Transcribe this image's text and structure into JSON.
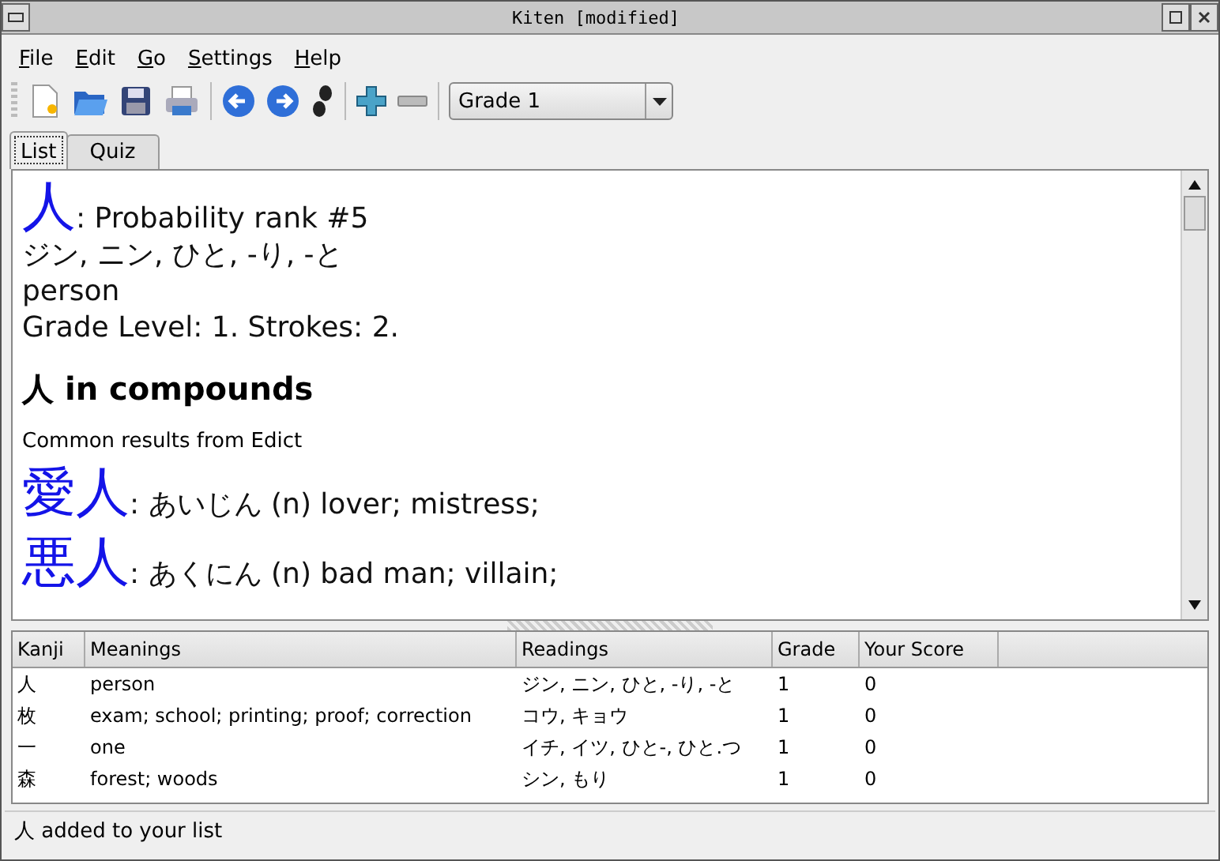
{
  "window": {
    "title": "Kiten [modified]"
  },
  "menu": [
    "File",
    "Edit",
    "Go",
    "Settings",
    "Help"
  ],
  "toolbar": {
    "grade_combo": "Grade 1"
  },
  "tabs": [
    {
      "label": "List",
      "selected": true
    },
    {
      "label": "Quiz",
      "selected": false
    }
  ],
  "entry": {
    "kanji": "人",
    "rank": ": Probability rank #5",
    "readings": "ジン, ニン, ひと, -り, -と",
    "meaning": "person",
    "grade_strokes": "Grade Level: 1. Strokes: 2.",
    "compounds_heading": "人 in compounds",
    "subheading": "Common results from Edict",
    "compounds": [
      {
        "word": "愛人",
        "definition": ": あいじん (n) lover; mistress;"
      },
      {
        "word": "悪人",
        "definition": ": あくにん (n) bad man; villain;"
      }
    ]
  },
  "table": {
    "columns": [
      "Kanji",
      "Meanings",
      "Readings",
      "Grade",
      "Your Score"
    ],
    "rows": [
      [
        "人",
        "person",
        "ジン, ニン, ひと, -り, -と",
        "1",
        "0"
      ],
      [
        "枚",
        "exam; school; printing; proof; correction",
        "コウ, キョウ",
        "1",
        "0"
      ],
      [
        "一",
        "one",
        "イチ, イツ, ひと-, ひと.つ",
        "1",
        "0"
      ],
      [
        "森",
        "forest; woods",
        "シン, もり",
        "1",
        "0"
      ]
    ]
  },
  "status_bar": "人 added to your list"
}
